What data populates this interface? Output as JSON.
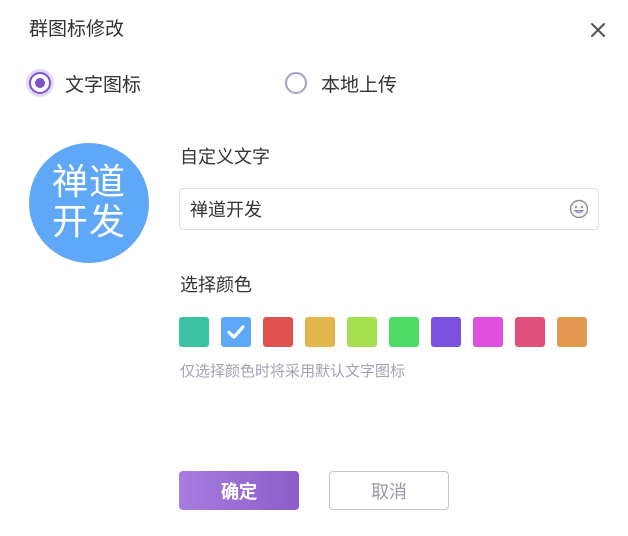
{
  "dialog": {
    "title": "群图标修改"
  },
  "icon_type": {
    "options": [
      {
        "label": "文字图标",
        "checked": true
      },
      {
        "label": "本地上传",
        "checked": false
      }
    ]
  },
  "avatar": {
    "text": "禅道开发",
    "color": "#5fa8f8"
  },
  "custom_text": {
    "label": "自定义文字",
    "value": "禅道开发",
    "emoji_icon": "smiley-icon"
  },
  "color_picker": {
    "label": "选择颜色",
    "selected_index": 1,
    "colors": [
      "#3cc2a2",
      "#5fa8f8",
      "#e05050",
      "#e3b54c",
      "#a6e04e",
      "#4fdc66",
      "#7b52e0",
      "#e050e0",
      "#e0507a",
      "#e39a50"
    ],
    "hint": "仅选择颜色时将采用默认文字图标"
  },
  "actions": {
    "confirm_label": "确定",
    "cancel_label": "取消"
  },
  "theme": {
    "accent": "#7b52c9"
  }
}
